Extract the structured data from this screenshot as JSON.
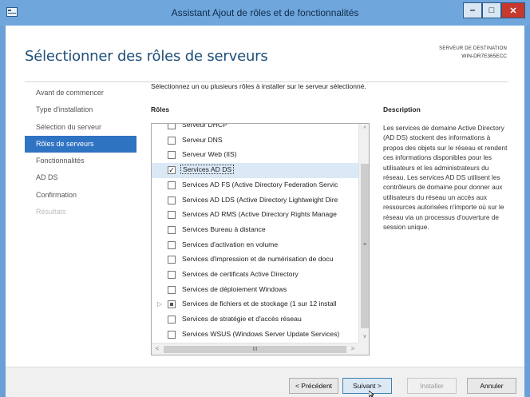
{
  "window": {
    "title": "Assistant Ajout de rôles et de fonctionnalités",
    "minimize": "‒",
    "maximize": "□",
    "close": "✕"
  },
  "header": {
    "page_title": "Sélectionner des rôles de serveurs",
    "destination_label": "SERVEUR DE DESTINATION",
    "destination_server": "WIN-DR7E365ECC"
  },
  "nav": {
    "items": [
      {
        "label": "Avant de commencer",
        "state": "normal"
      },
      {
        "label": "Type d'installation",
        "state": "normal"
      },
      {
        "label": "Sélection du serveur",
        "state": "normal"
      },
      {
        "label": "Rôles de serveurs",
        "state": "active"
      },
      {
        "label": "Fonctionnalités",
        "state": "normal"
      },
      {
        "label": "AD DS",
        "state": "normal"
      },
      {
        "label": "Confirmation",
        "state": "normal"
      },
      {
        "label": "Résultats",
        "state": "disabled"
      }
    ]
  },
  "main": {
    "instruction": "Sélectionnez un ou plusieurs rôles à installer sur le serveur sélectionné.",
    "roles_label": "Rôles",
    "description_label": "Description",
    "description_text": "Les services de domaine Active Directory (AD DS) stockent des informations à propos des objets sur le réseau et rendent ces informations disponibles pour les utilisateurs et les administrateurs du réseau. Les services AD DS utilisent les contrôleurs de domaine pour donner aux utilisateurs du réseau un accès aux ressources autorisées n'importe où sur le réseau via un processus d'ouverture de session unique.",
    "roles": [
      {
        "label": "Serveur DHCP",
        "checked": false
      },
      {
        "label": "Serveur DNS",
        "checked": false
      },
      {
        "label": "Serveur Web (IIS)",
        "checked": false
      },
      {
        "label": "Services AD DS",
        "checked": true,
        "selected": true
      },
      {
        "label": "Services AD FS (Active Directory Federation Servic",
        "checked": false
      },
      {
        "label": "Services AD LDS (Active Directory Lightweight Dire",
        "checked": false
      },
      {
        "label": "Services AD RMS (Active Directory Rights Manage",
        "checked": false
      },
      {
        "label": "Services Bureau à distance",
        "checked": false
      },
      {
        "label": "Services d'activation en volume",
        "checked": false
      },
      {
        "label": "Services d'impression et de numérisation de docu",
        "checked": false
      },
      {
        "label": "Services de certificats Active Directory",
        "checked": false
      },
      {
        "label": "Services de déploiement Windows",
        "checked": false
      },
      {
        "label": "Services de fichiers et de stockage (1 sur 12 install",
        "checked": "partial",
        "expandable": true
      },
      {
        "label": "Services de stratégie et d'accès réseau",
        "checked": false
      },
      {
        "label": "Services WSUS (Windows Server Update Services)",
        "checked": false
      }
    ],
    "scroll_grip": "III",
    "vscroll_up": "^",
    "vscroll_down": "v",
    "hscroll_left": "<",
    "hscroll_right": ">"
  },
  "footer": {
    "previous": "< Précédent",
    "next": "Suivant >",
    "install": "Installer",
    "cancel": "Annuler"
  },
  "colors": {
    "title_bar": "#6fa6dc",
    "accent": "#2f73c3",
    "close_button": "#c7382d",
    "page_title": "#1f4e79"
  }
}
